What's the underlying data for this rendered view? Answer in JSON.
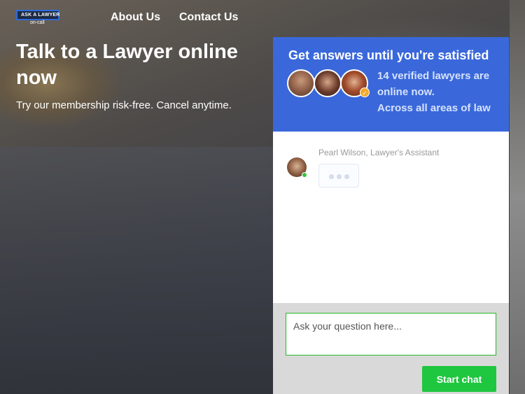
{
  "logo": {
    "line1": "ASK A LAWYER",
    "line2": "on-call"
  },
  "nav": {
    "about": "About Us",
    "contact": "Contact Us"
  },
  "hero": {
    "title": "Talk to a Lawyer online now",
    "subtitle": "Try our membership risk-free. Cancel anytime."
  },
  "panel": {
    "heading": "Get answers until you're satisfied",
    "online_line1": "14 verified lawyers are",
    "online_line2": "online now.",
    "online_line3": "Across all areas of law",
    "assistant_name": "Pearl Wilson, Lawyer's Assistant",
    "question_placeholder": "Ask your question here...",
    "start_button": "Start chat"
  },
  "colors": {
    "accent_blue": "#3a68db",
    "start_green": "#1fc63f",
    "input_border": "#25b725"
  }
}
